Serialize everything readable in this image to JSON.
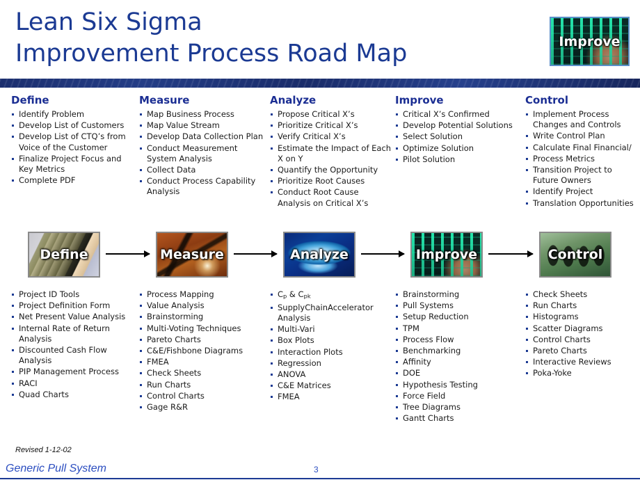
{
  "header": {
    "title_line1": "Lean Six Sigma",
    "title_line2": "Improvement Process Road Map",
    "thumbnail_label": "Improve",
    "thumbnail_icon": "improve-photo-icon",
    "accent_color": "#1b3a93",
    "bar_color": "#1a2c69"
  },
  "columns": [
    {
      "id": "define",
      "head": "Define",
      "tasks": [
        "Identify Problem",
        "Develop List of Customers",
        "Develop List of CTQ’s from Voice of the Customer",
        "Finalize Project Focus and Key Metrics",
        "Complete PDF"
      ],
      "node_label": "Define",
      "node_icon": "define-photo-icon",
      "tools": [
        "Project ID Tools",
        "Project Definition Form",
        "Net Present Value Analysis",
        "Internal Rate of Return Analysis",
        "Discounted Cash Flow Analysis",
        "PIP Management Process",
        "RACI",
        "Quad Charts"
      ]
    },
    {
      "id": "measure",
      "head": "Measure",
      "tasks": [
        "Map Business Process",
        "Map Value Stream",
        "Develop Data Collection Plan",
        "Conduct Measurement System Analysis",
        "Collect Data",
        "Conduct Process Capability Analysis"
      ],
      "node_label": "Measure",
      "node_icon": "measure-photo-icon",
      "tools": [
        "Process Mapping",
        "Value Analysis",
        "Brainstorming",
        "Multi-Voting Techniques",
        "Pareto Charts",
        "C&E/Fishbone Diagrams",
        "FMEA",
        "Check Sheets",
        "Run Charts",
        "Control Charts",
        "Gage R&R"
      ]
    },
    {
      "id": "analyze",
      "head": "Analyze",
      "tasks": [
        "Propose Critical X’s",
        "Prioritize Critical X’s",
        "Verify Critical X’s",
        "Estimate the Impact of Each X on Y",
        "Quantify the Opportunity",
        "Prioritize Root Causes",
        "Conduct Root Cause Analysis on Critical X’s"
      ],
      "node_label": "Analyze",
      "node_icon": "analyze-photo-icon",
      "tools": [
        "Cp & Cpk",
        "SupplyChainAccelerator Analysis",
        "Multi-Vari",
        "Box Plots",
        "Interaction Plots",
        "Regression",
        "ANOVA",
        "C&E Matrices",
        "FMEA"
      ]
    },
    {
      "id": "improve",
      "head": "Improve",
      "tasks": [
        "Critical X’s Confirmed",
        "Develop Potential Solutions",
        "Select Solution",
        "Optimize Solution",
        "Pilot Solution"
      ],
      "node_label": "Improve",
      "node_icon": "improve-photo-icon",
      "tools": [
        "Brainstorming",
        "Pull Systems",
        "Setup Reduction",
        "TPM",
        "Process Flow",
        "Benchmarking",
        "Affinity",
        "DOE",
        "Hypothesis Testing",
        "Force Field",
        "Tree Diagrams",
        "Gantt Charts"
      ]
    },
    {
      "id": "control",
      "head": "Control",
      "tasks": [
        "Implement Process Changes and Controls",
        "Write Control Plan",
        "Calculate Final Financial/",
        "Process Metrics",
        "Transition Project to Future Owners",
        "Identify Project",
        "Translation Opportunities"
      ],
      "node_label": "Control",
      "node_icon": "control-photo-icon",
      "tools": [
        "Check Sheets",
        "Run Charts",
        "Histograms",
        "Scatter Diagrams",
        "Control Charts",
        "Pareto Charts",
        "Interactive Reviews",
        "Poka-Yoke"
      ]
    }
  ],
  "footer": {
    "revised": "Revised 1-12-02",
    "title": "Generic Pull System",
    "page_number": "3"
  }
}
